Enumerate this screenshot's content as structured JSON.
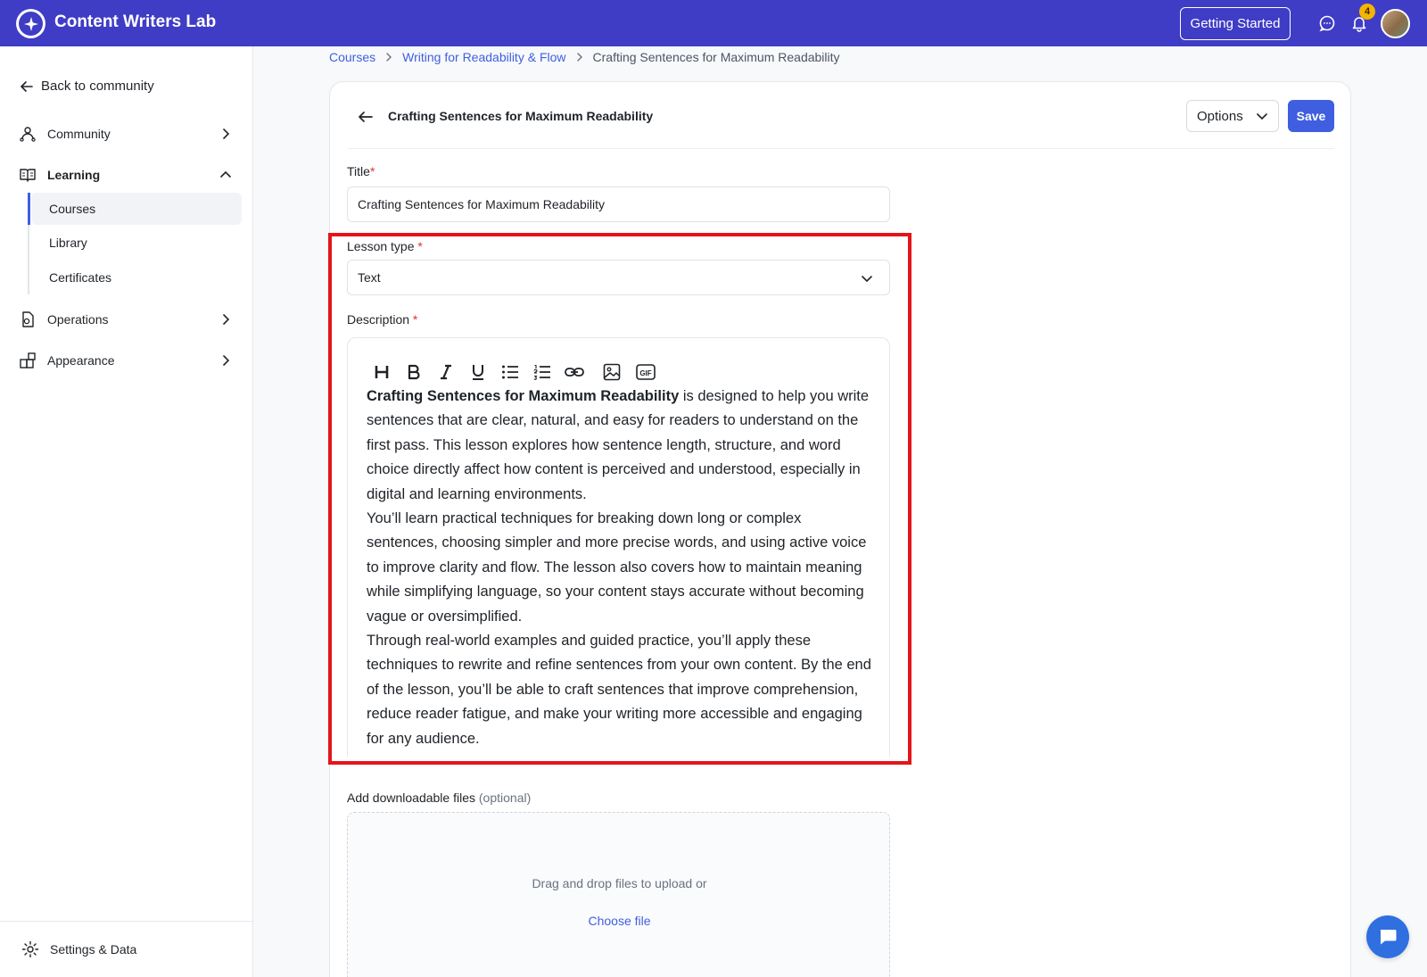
{
  "app": {
    "title": "Content Writers Lab",
    "getting_started_label": "Getting Started",
    "notification_count": "4"
  },
  "sidebar": {
    "back_label": "Back to community",
    "items": [
      {
        "label": "Community",
        "icon": "community-icon",
        "expanded": false
      },
      {
        "label": "Learning",
        "icon": "book-icon",
        "expanded": true
      },
      {
        "label": "Operations",
        "icon": "operations-icon",
        "expanded": false
      },
      {
        "label": "Appearance",
        "icon": "appearance-icon",
        "expanded": false
      }
    ],
    "learning_subitems": [
      {
        "label": "Courses",
        "active": true
      },
      {
        "label": "Library",
        "active": false
      },
      {
        "label": "Certificates",
        "active": false
      }
    ],
    "settings_label": "Settings & Data"
  },
  "breadcrumb": {
    "items": [
      "Courses",
      "Writing for Readability & Flow"
    ],
    "current": "Crafting Sentences for Maximum Readability"
  },
  "lesson": {
    "header_title": "Crafting Sentences for Maximum Readability",
    "options_label": "Options",
    "save_label": "Save",
    "title_label": "Title",
    "title_value": "Crafting Sentences for Maximum Readability",
    "type_label": "Lesson type",
    "type_value": "Text",
    "description_label": "Description",
    "required_mark": "*",
    "description": {
      "bold_lead": "Crafting Sentences for Maximum Readability",
      "p1_rest": " is designed to help you write sentences that are clear, natural, and easy for readers to understand on the first pass. This lesson explores how sentence length, structure, and word choice directly affect how content is perceived and understood, especially in digital and learning environments.",
      "p2": "You’ll learn practical techniques for breaking down long or complex sentences, choosing simpler and more precise words, and using active voice to improve clarity and flow. The lesson also covers how to maintain meaning while simplifying language, so your content stays accurate without becoming vague or oversimplified.",
      "p3": "Through real-world examples and guided practice, you’ll apply these techniques to rewrite and refine sentences from your own content. By the end of the lesson, you’ll be able to craft sentences that improve comprehension, reduce reader fatigue, and make your writing more accessible and engaging for any audience."
    },
    "toolbar": [
      "heading",
      "bold",
      "italic",
      "underline",
      "bullet-list",
      "numbered-list",
      "link",
      "image",
      "gif"
    ],
    "files_label": "Add downloadable files",
    "files_optional": "(optional)",
    "dropzone_text": "Drag and drop files to upload or",
    "choose_file_label": "Choose file"
  },
  "colors": {
    "brand": "#3f3cc6",
    "accent": "#3f5fe0",
    "highlight": "#e3151b",
    "badge": "#f5b400"
  }
}
